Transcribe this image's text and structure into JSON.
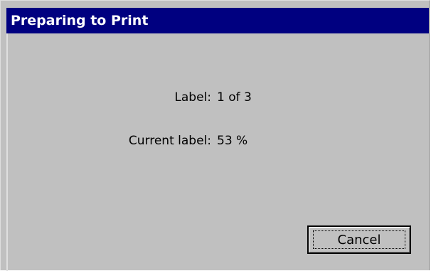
{
  "window": {
    "title": "Preparing to Print"
  },
  "progress": {
    "label_caption": "Label:",
    "label_value": "1 of 3",
    "current_caption": "Current label:",
    "current_value": "53 %"
  },
  "buttons": {
    "cancel_label": "Cancel"
  },
  "colors": {
    "titlebar": "#000080",
    "dialog_face": "#c0c0c0"
  }
}
